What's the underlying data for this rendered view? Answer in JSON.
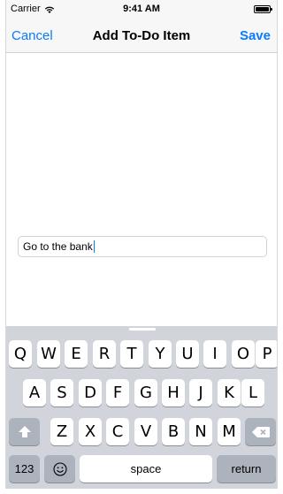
{
  "status_bar": {
    "carrier": "Carrier",
    "time": "9:41 AM",
    "wifi_icon": "wifi-icon",
    "battery_icon": "battery-icon"
  },
  "nav_bar": {
    "cancel_label": "Cancel",
    "title": "Add To-Do Item",
    "save_label": "Save",
    "accent_color": "#0a7aff"
  },
  "form": {
    "item_value": "Go to the bank"
  },
  "keyboard": {
    "row1": [
      "Q",
      "W",
      "E",
      "R",
      "T",
      "Y",
      "U",
      "I",
      "O",
      "P"
    ],
    "row2": [
      "A",
      "S",
      "D",
      "F",
      "G",
      "H",
      "J",
      "K",
      "L"
    ],
    "row3_letters": [
      "Z",
      "X",
      "C",
      "V",
      "B",
      "N",
      "M"
    ],
    "shift_icon": "shift-icon",
    "delete_icon": "delete-icon",
    "numbers_label": "123",
    "emoji_icon": "emoji-icon",
    "space_label": "space",
    "return_label": "return"
  }
}
